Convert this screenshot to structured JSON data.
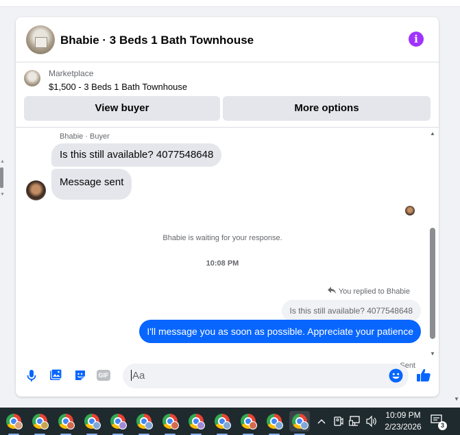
{
  "header": {
    "title": "Bhabie · 3 Beds 1 Bath Townhouse",
    "info_icon": "info-icon",
    "accent": "#a033ff"
  },
  "listing": {
    "source": "Marketplace",
    "price_title": "$1,500 - 3 Beds 1 Bath Townhouse",
    "view_buyer_label": "View buyer",
    "more_options_label": "More options"
  },
  "messages": {
    "sender_label": "Bhabie · Buyer",
    "incoming": [
      {
        "text": "Is this still available? 4077548648"
      },
      {
        "text": "Message sent"
      }
    ],
    "waiting_notice": "Bhabie is waiting for your response.",
    "timestamp": "10:08 PM",
    "replied_label": "You replied to Bhabie",
    "quoted_text": "Is this still available? 4077548648",
    "outgoing_text": "I'll message you as soon as possible. Appreciate your patience",
    "status": "Sent"
  },
  "composer": {
    "placeholder": "Aa",
    "gif_label": "GIF",
    "icons": [
      "microphone-icon",
      "photo-icon",
      "sticker-icon",
      "gif-icon",
      "emoji-icon",
      "thumbs-up-icon"
    ],
    "accent": "#0866ff"
  },
  "taskbar": {
    "app_count": 12,
    "time": "10:09 PM",
    "date": "2/23/2026",
    "notification_count": "3"
  }
}
